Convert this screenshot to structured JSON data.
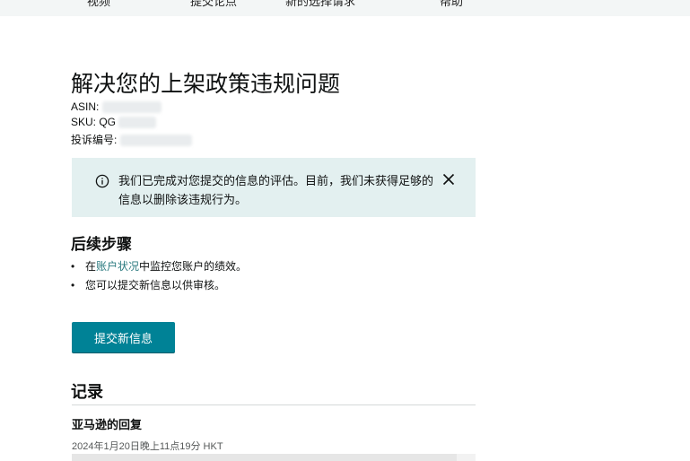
{
  "topnav": {
    "items": [
      "视频",
      "提交论点",
      "新的选择请求",
      "帮助"
    ]
  },
  "page": {
    "title": "解决您的上架政策违规问题",
    "asin_label": "ASIN:",
    "sku_label": "SKU: QG",
    "complaint_label": "投诉编号:"
  },
  "alert": {
    "icon": "info-icon",
    "message": "我们已完成对您提交的信息的评估。目前，我们未获得足够的信息以删除该违规行为。",
    "close_icon": "close-icon",
    "background": "#e3f0f0"
  },
  "next_steps": {
    "heading": "后续步骤",
    "items": [
      {
        "prefix": "在",
        "link": "账户状况",
        "suffix": "中监控您账户的绩效。"
      },
      {
        "prefix": "您可以提交新信息以供审核。",
        "link": "",
        "suffix": ""
      }
    ]
  },
  "submit_button": {
    "label": "提交新信息",
    "color": "#008296"
  },
  "history": {
    "heading": "记录",
    "entries": [
      {
        "title": "亚马逊的回复",
        "timestamp": "2024年1月20日晚上11点19分 HKT"
      }
    ]
  }
}
